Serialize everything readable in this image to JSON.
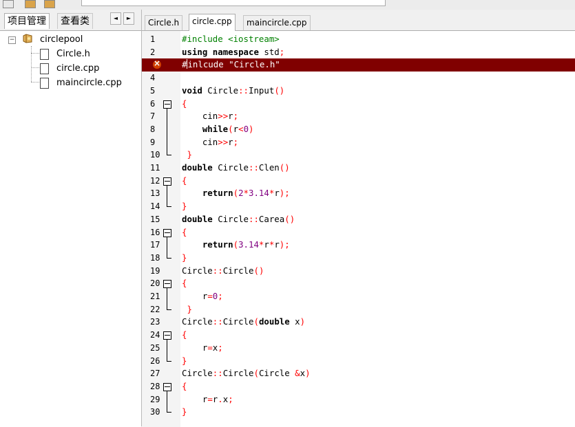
{
  "left_panel": {
    "tabs": [
      {
        "label": "项目管理",
        "active": true
      },
      {
        "label": "查看类",
        "active": false
      }
    ],
    "scroll_left": "◄",
    "scroll_right": "►",
    "project": {
      "name": "circlepool",
      "files": [
        "Circle.h",
        "circle.cpp",
        "maincircle.cpp"
      ]
    }
  },
  "editor_tabs": [
    {
      "label": "Circle.h",
      "active": false
    },
    {
      "label": "circle.cpp",
      "active": true
    },
    {
      "label": "maincircle.cpp",
      "active": false
    }
  ],
  "error_line": 3,
  "colors": {
    "error_line_bg": "#800000",
    "keyword": "#000000",
    "preprocessor": "#008000",
    "operator": "#ff0000",
    "number": "#800080"
  },
  "code_lines": [
    {
      "n": "1",
      "text": "#include <iostream>"
    },
    {
      "n": "2",
      "text": "using namespace std;"
    },
    {
      "n": "",
      "text": "#inlcude \"Circle.h\""
    },
    {
      "n": "4",
      "text": ""
    },
    {
      "n": "5",
      "text": "void Circle::Input()"
    },
    {
      "n": "6",
      "text": "{"
    },
    {
      "n": "7",
      "text": "    cin>>r;"
    },
    {
      "n": "8",
      "text": "    while(r<0)"
    },
    {
      "n": "9",
      "text": "    cin>>r;"
    },
    {
      "n": "10",
      "text": " }"
    },
    {
      "n": "11",
      "text": "double Circle::Clen()"
    },
    {
      "n": "12",
      "text": "{"
    },
    {
      "n": "13",
      "text": "    return(2*3.14*r);"
    },
    {
      "n": "14",
      "text": "}"
    },
    {
      "n": "15",
      "text": "double Circle::Carea()"
    },
    {
      "n": "16",
      "text": "{"
    },
    {
      "n": "17",
      "text": "    return(3.14*r*r);"
    },
    {
      "n": "18",
      "text": "}"
    },
    {
      "n": "19",
      "text": "Circle::Circle()"
    },
    {
      "n": "20",
      "text": "{"
    },
    {
      "n": "21",
      "text": "    r=0;"
    },
    {
      "n": "22",
      "text": " }"
    },
    {
      "n": "23",
      "text": "Circle::Circle(double x)"
    },
    {
      "n": "24",
      "text": "{"
    },
    {
      "n": "25",
      "text": "    r=x;"
    },
    {
      "n": "26",
      "text": "}"
    },
    {
      "n": "27",
      "text": "Circle::Circle(Circle &x)"
    },
    {
      "n": "28",
      "text": "{"
    },
    {
      "n": "29",
      "text": "    r=r.x;"
    },
    {
      "n": "30",
      "text": "}"
    }
  ]
}
